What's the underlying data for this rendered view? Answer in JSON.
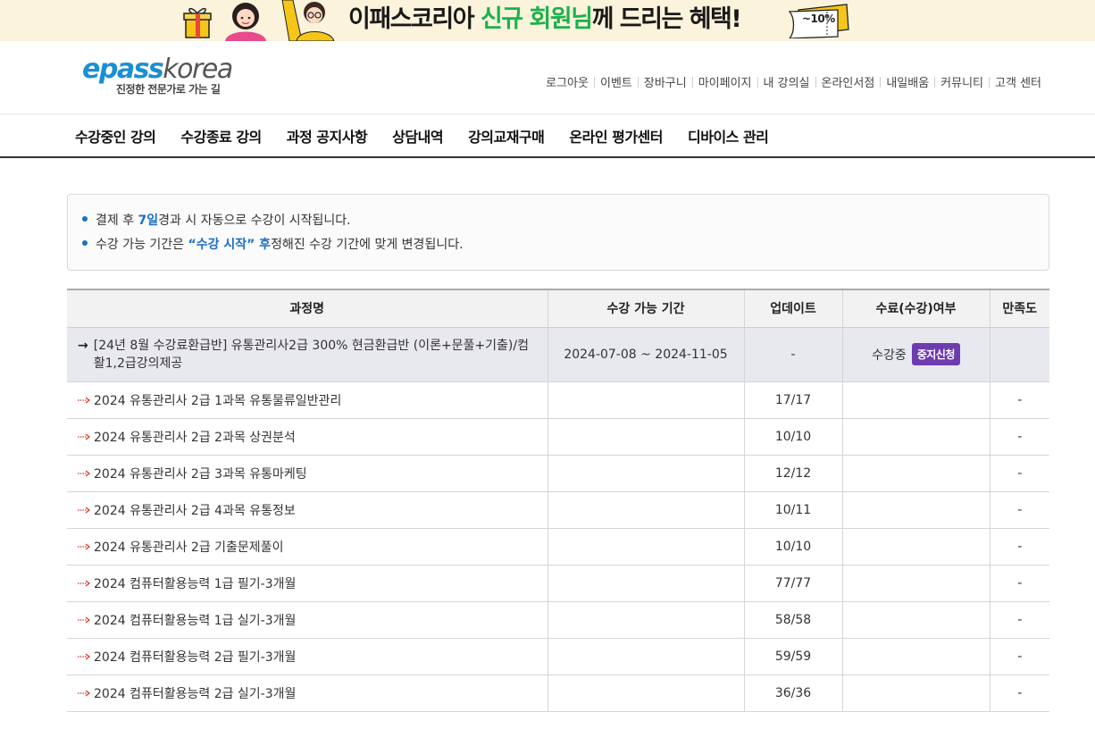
{
  "promo": {
    "title_part1": "이패스코리아 ",
    "title_highlight": "신규 회원님",
    "title_part2": "께 드리는 혜택!",
    "ticket_text": "~10%"
  },
  "brand": {
    "logo_e": "e",
    "logo_pass": "pass",
    "logo_korea": "korea",
    "tagline": "진정한 전문가로 가는 길"
  },
  "util_links": [
    "로그아웃",
    "이벤트",
    "장바구니",
    "마이페이지",
    "내 강의실",
    "온라인서점",
    "내일배움",
    "커뮤니티",
    "고객 센터"
  ],
  "main_nav": [
    "수강중인 강의",
    "수강종료 강의",
    "과정 공지사항",
    "상담내역",
    "강의교재구매",
    "온라인 평가센터",
    "디바이스 관리"
  ],
  "notice": {
    "line1_a": "결제 후 ",
    "line1_b": "7일",
    "line1_c": " 경과 시 자동으로 수강이 시작됩니다.",
    "line2_a": "수강 가능 기간은 ",
    "line2_b": "“수강 시작” 후",
    "line2_c": " 정해진 수강 기간에 맞게 변경됩니다."
  },
  "table": {
    "headers": [
      "과정명",
      "수강 가능 기간",
      "업데이트",
      "수료(수강)여부",
      "만족도"
    ],
    "main_row": {
      "arrow": "→",
      "name": "[24년 8월 수강료환급반] 유통관리사2급 300% 현금환급반 (이론+문풀+기출)/컴활1,2급강의제공",
      "period": "2024-07-08 ~ 2024-11-05",
      "update": "-",
      "status": "수강중",
      "stop_button": "중지신청",
      "satisfaction": ""
    },
    "rows": [
      {
        "name": "2024 유통관리사 2급 1과목 유통물류일반관리",
        "update": "17/17",
        "satisfaction": "-"
      },
      {
        "name": "2024 유통관리사 2급 2과목 상권분석",
        "update": "10/10",
        "satisfaction": "-"
      },
      {
        "name": "2024 유통관리사 2급 3과목 유통마케팅",
        "update": "12/12",
        "satisfaction": "-"
      },
      {
        "name": "2024 유통관리사 2급 4과목 유통정보",
        "update": "10/11",
        "satisfaction": "-"
      },
      {
        "name": "2024 유통관리사 2급 기출문제풀이",
        "update": "10/10",
        "satisfaction": "-"
      },
      {
        "name": "2024 컴퓨터활용능력 1급 필기-3개월",
        "update": "77/77",
        "satisfaction": "-"
      },
      {
        "name": "2024 컴퓨터활용능력 1급 실기-3개월",
        "update": "58/58",
        "satisfaction": "-"
      },
      {
        "name": "2024 컴퓨터활용능력 2급 필기-3개월",
        "update": "59/59",
        "satisfaction": "-"
      },
      {
        "name": "2024 컴퓨터활용능력 2급 실기-3개월",
        "update": "36/36",
        "satisfaction": "-"
      }
    ]
  },
  "colors": {
    "accent_blue": "#1a6fc4",
    "logo_blue": "#1a8fd3",
    "promo_green": "#1bb24b",
    "stop_button_purple": "#6f3cb0",
    "sub_arrow_red": "#d9342b"
  }
}
